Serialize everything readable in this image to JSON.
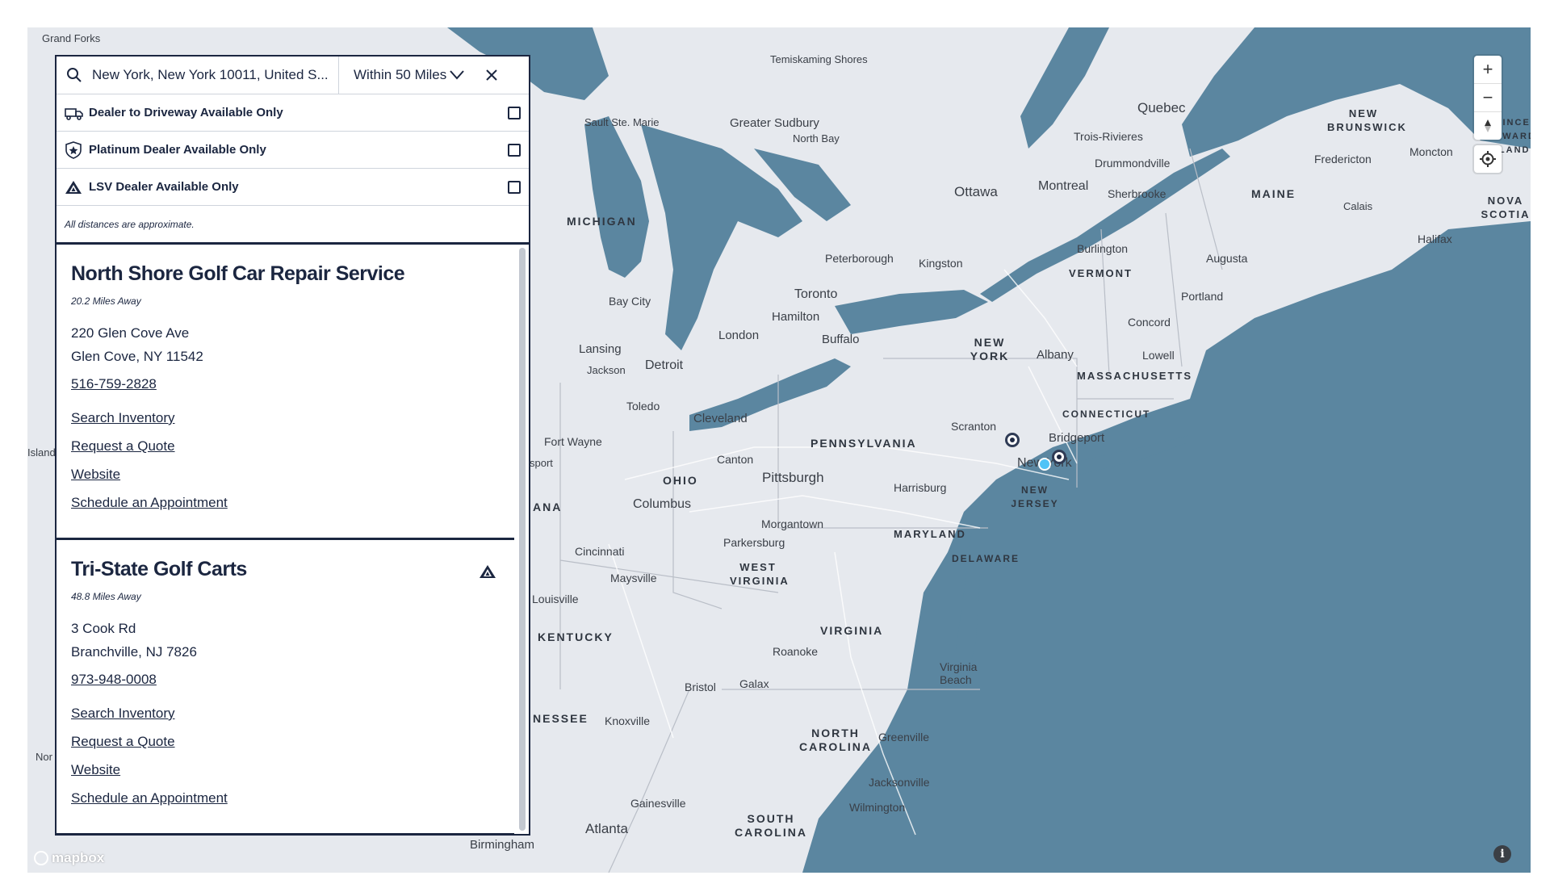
{
  "search": {
    "location_value": "New York, New York 10011, United S...",
    "radius_label": "Within 50 Miles"
  },
  "filters": [
    {
      "label": "Dealer to Driveway Available Only",
      "icon": "truck-icon",
      "checked": false
    },
    {
      "label": "Platinum Dealer Available Only",
      "icon": "star-shield-icon",
      "checked": false
    },
    {
      "label": "LSV Dealer Available Only",
      "icon": "lsv-icon",
      "checked": false
    }
  ],
  "note": "All distances are approximate.",
  "dealers": [
    {
      "name": "North Shore Golf Car Repair Service",
      "distance": "20.2 Miles Away",
      "address_line1": "220 Glen Cove Ave",
      "address_line2": "Glen Cove, NY 11542",
      "phone": "516-759-2828",
      "links": [
        "Search Inventory",
        "Request a Quote",
        "Website",
        "Schedule an Appointment"
      ],
      "lsv": false
    },
    {
      "name": "Tri-State Golf Carts",
      "distance": "48.8 Miles Away",
      "address_line1": "3 Cook Rd",
      "address_line2": "Branchville, NJ 7826",
      "phone": "973-948-0008",
      "links": [
        "Search Inventory",
        "Request a Quote",
        "Website",
        "Schedule an Appointment"
      ],
      "lsv": true
    }
  ],
  "map": {
    "attribution_logo": "mapbox",
    "colors": {
      "water": "#5b86a0",
      "land": "#e6e9ee",
      "panel_border": "#1b2640"
    },
    "zoom_in_label": "+",
    "zoom_out_label": "−",
    "place_labels": [
      "Grand Forks",
      "Sault Ste. Marie",
      "Greater Sudbury",
      "North Bay",
      "Temiskaming Shores",
      "Quebec",
      "Trois-Rivieres",
      "Drummondville",
      "Montreal",
      "Sherbrooke",
      "Ottawa",
      "Fredericton",
      "Moncton",
      "Calais",
      "Halifax",
      "Augusta",
      "Burlington",
      "Portland",
      "Concord",
      "Lowell",
      "Albany",
      "Peterborough",
      "Kingston",
      "Toronto",
      "Hamilton",
      "Buffalo",
      "London",
      "Bay City",
      "Lansing",
      "Detroit",
      "Jackson",
      "Toledo",
      "Cleveland",
      "Fort Wayne",
      "Canton",
      "Pittsburgh",
      "Columbus",
      "Harrisburg",
      "Scranton",
      "Bridgeport",
      "New York",
      "Morgantown",
      "Parkersburg",
      "Cincinnati",
      "Maysville",
      "Louisville",
      "Roanoke",
      "Bristol",
      "Galax",
      "Knoxville",
      "Greenville",
      "Virginia Beach",
      "Jacksonville",
      "Wilmington",
      "Gainesville",
      "Atlanta",
      "Birmingham",
      "Nor",
      "Island",
      "sport"
    ],
    "region_labels": [
      "MICHIGAN",
      "NEW BRUNSWICK",
      "MAINE",
      "NOVA SCOTIA",
      "VERMONT",
      "NEW YORK",
      "MASSACHUSETTS",
      "CONNECTICUT",
      "PENNSYLVANIA",
      "OHIO",
      "NEW JERSEY",
      "MARYLAND",
      "DELAWARE",
      "WEST VIRGINIA",
      "VIRGINIA",
      "KENTUCKY",
      "NORTH CAROLINA",
      "SOUTH CAROLINA",
      "ANA",
      "NESSEE",
      "PRINCE EDWARD ISLAND"
    ]
  }
}
